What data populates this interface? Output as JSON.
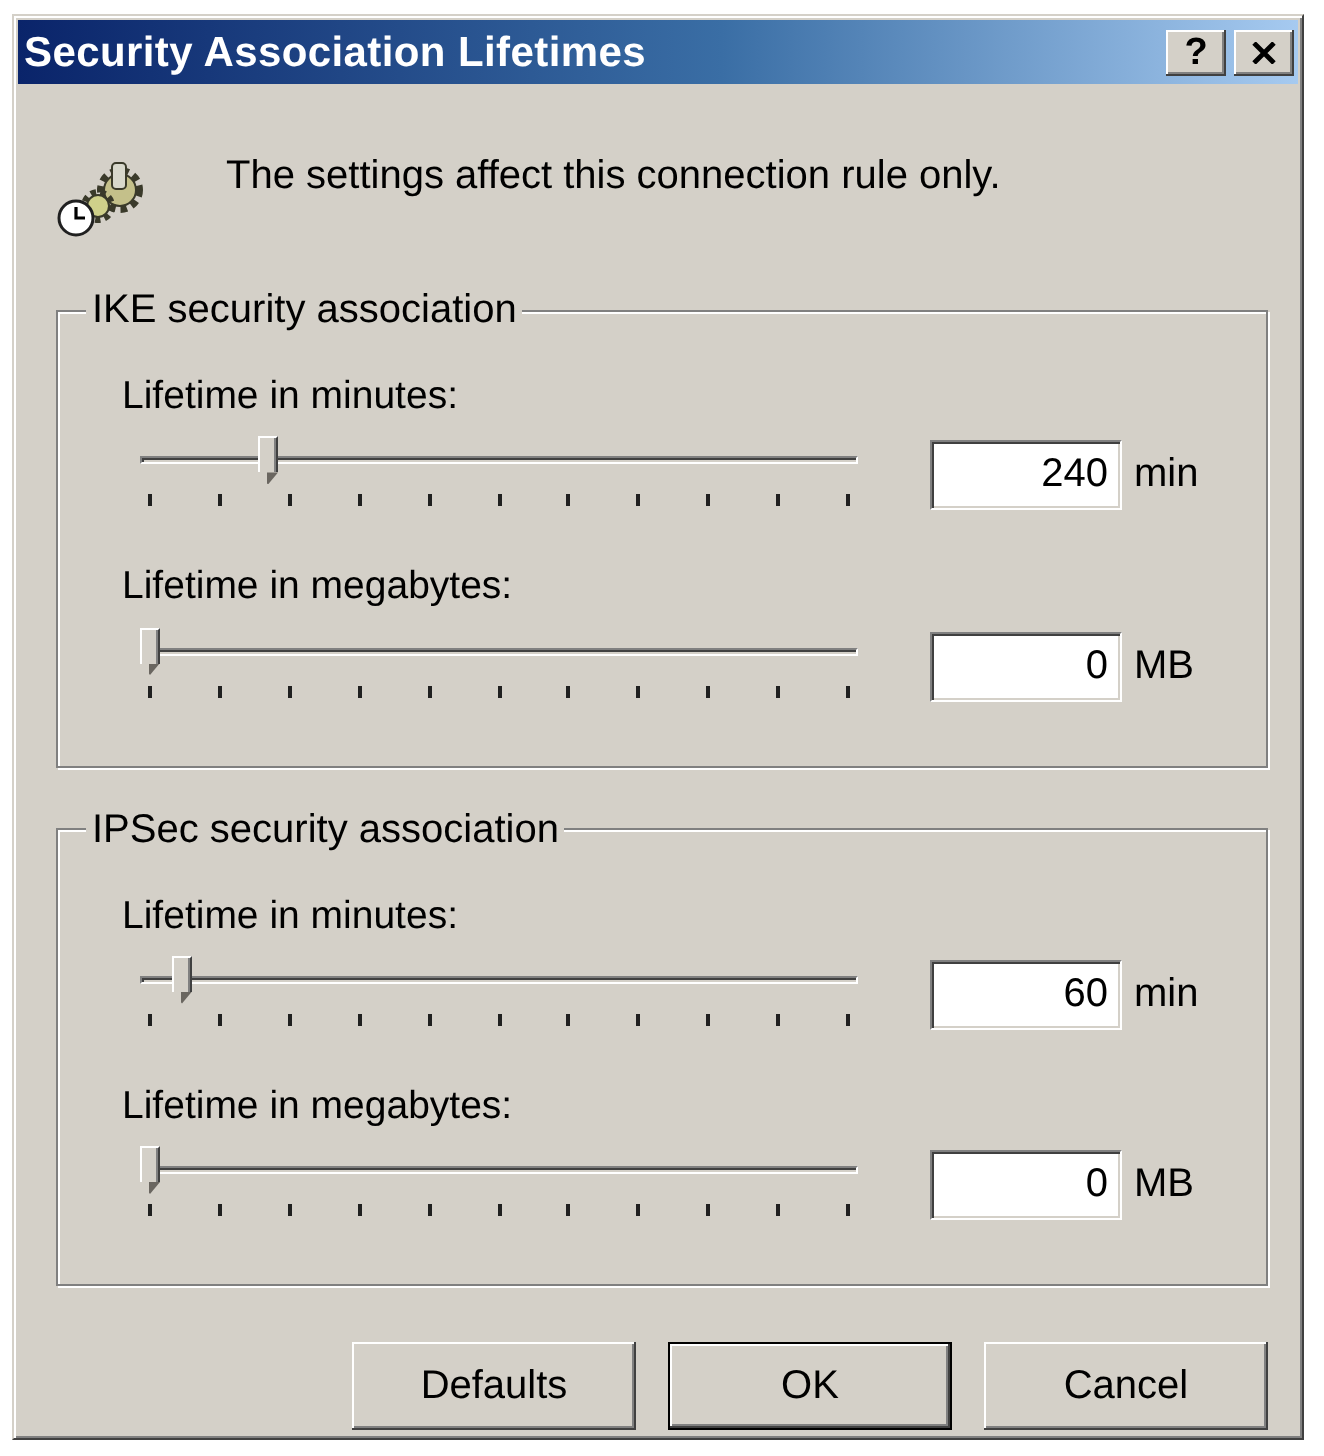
{
  "window": {
    "title": "Security Association Lifetimes",
    "title_buttons": [
      {
        "kind": "help",
        "label": "?"
      },
      {
        "kind": "close"
      }
    ]
  },
  "info": {
    "text": "The settings affect this connection rule only."
  },
  "groups": [
    {
      "title": "IKE security association",
      "settings": [
        {
          "label": "Lifetime in minutes:",
          "level": 0.17,
          "value": "240",
          "unit": "min"
        },
        {
          "label": "Lifetime in megabytes:",
          "level": 0,
          "value": "0",
          "unit": "MB"
        }
      ]
    },
    {
      "title": "IPSec security association",
      "settings": [
        {
          "label": "Lifetime in minutes:",
          "level": 0.045,
          "value": "60",
          "unit": "min"
        },
        {
          "label": "Lifetime in megabytes:",
          "level": 0,
          "value": "0",
          "unit": "MB"
        }
      ]
    }
  ],
  "buttons": [
    {
      "label": "Defaults",
      "default": false
    },
    {
      "label": "OK",
      "default": true
    },
    {
      "label": "Cancel",
      "default": false
    }
  ]
}
